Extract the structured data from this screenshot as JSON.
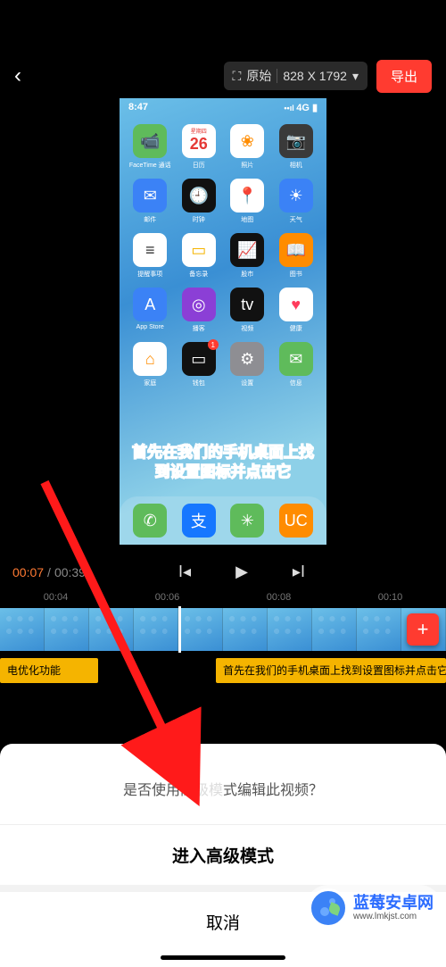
{
  "header": {
    "ratio_label": "原始",
    "resolution": "828 X 1792",
    "export_label": "导出"
  },
  "phone": {
    "time": "8:47",
    "signal": "4G",
    "caption": "首先在我们的手机桌面上找到设置图标并点击它",
    "apps_row1": [
      {
        "label": "FaceTime 通话",
        "bg": "#5fbb5b",
        "glyph": "📹"
      },
      {
        "label": "日历",
        "bg": "#ffffff",
        "glyph": "26",
        "text": "#e53935",
        "top": "星期四"
      },
      {
        "label": "照片",
        "bg": "#ffffff",
        "glyph": "❀",
        "text": "#ff8c00"
      },
      {
        "label": "相机",
        "bg": "#3a3a3a",
        "glyph": "📷"
      }
    ],
    "apps_row2": [
      {
        "label": "邮件",
        "bg": "#3b82f6",
        "glyph": "✉︎"
      },
      {
        "label": "时钟",
        "bg": "#111",
        "glyph": "🕘"
      },
      {
        "label": "地图",
        "bg": "#fff",
        "glyph": "📍",
        "text": "#2b8cff"
      },
      {
        "label": "天气",
        "bg": "#3b82f6",
        "glyph": "☀︎"
      }
    ],
    "apps_row3": [
      {
        "label": "提醒事项",
        "bg": "#fff",
        "glyph": "≡",
        "text": "#333"
      },
      {
        "label": "备忘录",
        "bg": "#fff",
        "glyph": "▭",
        "text": "#f5b400"
      },
      {
        "label": "股市",
        "bg": "#111",
        "glyph": "📈"
      },
      {
        "label": "图书",
        "bg": "#ff8c00",
        "glyph": "📖"
      }
    ],
    "apps_row4": [
      {
        "label": "App Store",
        "bg": "#3b82f6",
        "glyph": "A"
      },
      {
        "label": "播客",
        "bg": "#8b3fd6",
        "glyph": "◎"
      },
      {
        "label": "视频",
        "bg": "#111",
        "glyph": "tv"
      },
      {
        "label": "健康",
        "bg": "#fff",
        "glyph": "♥",
        "text": "#ff3b5c"
      }
    ],
    "apps_row5": [
      {
        "label": "家庭",
        "bg": "#fff",
        "glyph": "⌂",
        "text": "#ff8c00"
      },
      {
        "label": "钱包",
        "bg": "#111",
        "glyph": "▭",
        "badge": "1"
      },
      {
        "label": "设置",
        "bg": "#8e8e93",
        "glyph": "⚙"
      },
      {
        "label": "信息",
        "bg": "#5fbb5b",
        "glyph": "✉"
      }
    ],
    "dock": [
      {
        "bg": "#5fbb5b",
        "glyph": "✆"
      },
      {
        "bg": "#1677ff",
        "glyph": "支",
        "text": "#fff"
      },
      {
        "bg": "#5fbb5b",
        "glyph": "✳"
      },
      {
        "bg": "#ff8c00",
        "glyph": "UC"
      }
    ]
  },
  "playback": {
    "current": "00:07",
    "total": "00:39",
    "ruler": [
      "00:04",
      "00:06",
      "00:08",
      "00:10"
    ]
  },
  "subs": {
    "clip1": "电优化功能",
    "clip2": "首先在我们的手机桌面上找到设置图标并点击它"
  },
  "sheet": {
    "prompt_prefix": "是否使用高",
    "prompt_suffix": "式编辑此视频？",
    "confirm": "进入高级模式",
    "cancel": "取消"
  },
  "watermark": {
    "title": "蓝莓安卓网",
    "url": "www.lmkjst.com"
  }
}
